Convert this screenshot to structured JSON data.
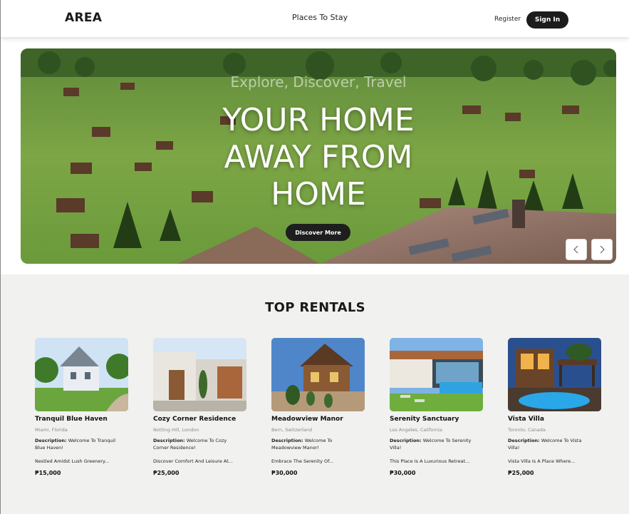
{
  "header": {
    "logo": "AREA",
    "nav_center": "Places To Stay",
    "register": "Register",
    "sign_in": "Sign In"
  },
  "hero": {
    "tagline": "Explore, Discover, Travel",
    "headline_lines": [
      "YOUR HOME",
      "AWAY FROM",
      "HOME"
    ],
    "cta": "Discover More",
    "prev_icon": "chevron-left-icon",
    "next_icon": "chevron-right-icon"
  },
  "rentals": {
    "title": "TOP RENTALS",
    "desc_label": "Description:",
    "items": [
      {
        "name": "Tranquil Blue Haven",
        "location": "Miami, Florida",
        "desc": "Welcome To Tranquil Blue Haven!",
        "more": "Nestled Amidst Lush Greenery...",
        "price": "₱15,000"
      },
      {
        "name": "Cozy Corner Residence",
        "location": "Notting Hill, London",
        "desc": "Welcome To Cozy Corner Residence!",
        "more": "Discover Comfort And Leisure At...",
        "price": "₱25,000"
      },
      {
        "name": "Meadowview Manor",
        "location": "Bern, Switzerland",
        "desc": "Welcome To Meadowview Manor!",
        "more": "Embrace The Serenity Of...",
        "price": "₱30,000"
      },
      {
        "name": "Serenity Sanctuary",
        "location": "Los Angeles, California",
        "desc": "Welcome To Serenity Villa!",
        "more": "This Place Is A Luxurious Retreat...",
        "price": "₱30,000"
      },
      {
        "name": "Vista Villa",
        "location": "Toronto, Canada",
        "desc": "Welcome To Vista Villa!",
        "more": "Vista Villa Is A Place Where...",
        "price": "₱25,000"
      }
    ]
  }
}
